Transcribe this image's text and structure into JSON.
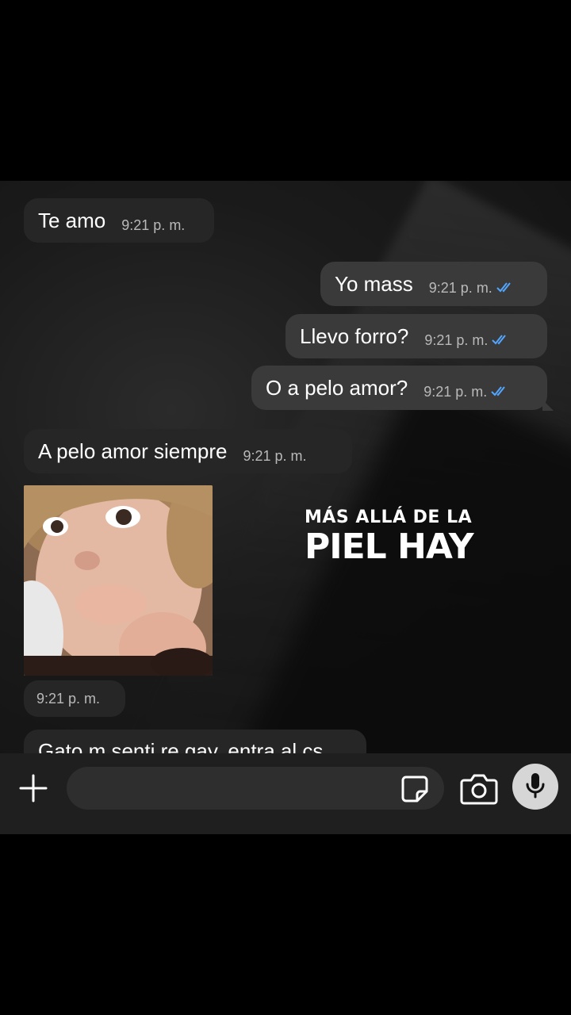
{
  "messages": [
    {
      "direction": "in",
      "text": "Te amo",
      "time": "9:21 p. m."
    },
    {
      "direction": "out",
      "text": "Yo mass",
      "time": "9:21 p. m.",
      "status": "read-double-check-icon"
    },
    {
      "direction": "out",
      "text": "Llevo forro?",
      "time": "9:21 p. m.",
      "status": "read-double-check-icon"
    },
    {
      "direction": "out",
      "text": "O a pelo amor?",
      "time": "9:21 p. m.",
      "status": "read-double-check-icon"
    },
    {
      "direction": "in",
      "text": "A pelo amor siempre",
      "time": "9:21 p. m."
    },
    {
      "direction": "in",
      "type": "image",
      "time": "9:21 p. m."
    },
    {
      "direction": "in",
      "text": "Gato m senti re gay, entra al cs",
      "partial": true
    }
  ],
  "overlay": {
    "line1": "MÁS ALLÁ DE LA",
    "line2": "PIEL HAY"
  },
  "composer": {
    "placeholder": "",
    "icons": [
      "plus-icon",
      "sticker-icon",
      "camera-icon",
      "microphone-icon"
    ]
  },
  "colors": {
    "incoming_bubble": "#262626",
    "outgoing_bubble": "#3a3a3a",
    "read_ticks": "#53a6ff",
    "mic_button": "#d6d6d6"
  }
}
